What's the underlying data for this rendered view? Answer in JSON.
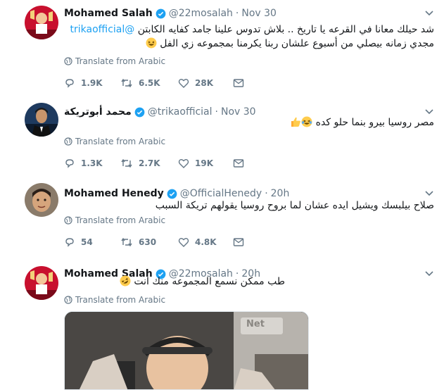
{
  "tweets": [
    {
      "name": "Mohamed Salah",
      "handle": "@22mosalah",
      "time": "Nov 30",
      "mention": "@trikaofficial",
      "line1": " شد حيلك معانا في القرعه يا تاريخ .. بلاش تدوس علينا جامد كفايه الكابتن",
      "line2": "مجدي زمانه بيصلي من أسبوع علشان ربنا يكرمنا بمجموعه زي الفل",
      "translate": "Translate from Arabic",
      "replies": "1.9K",
      "retweets": "6.5K",
      "likes": "28K"
    },
    {
      "name": "محمد أبوتريكة",
      "handle": "@trikaofficial",
      "time": "Nov 30",
      "line1": "مصر روسيا بيرو بنما حلو كده",
      "translate": "Translate from Arabic",
      "replies": "1.3K",
      "retweets": "2.7K",
      "likes": "19K"
    },
    {
      "name": "Mohamed Henedy",
      "handle": "@OfficialHenedy",
      "time": "20h",
      "line1": "صلاح بيلبسك ويشيل ايده عشان لما بروح روسيا يقولهم تريكة السبب",
      "translate": "Translate from Arabic",
      "replies": "54",
      "retweets": "630",
      "likes": "4.8K"
    },
    {
      "name": "Mohamed Salah",
      "handle": "@22mosalah",
      "time": "20h",
      "line1": "طب ممكن نسمع المجموعه منك انت",
      "translate": "Translate from Arabic",
      "media_watermark": "Net"
    }
  ],
  "colors": {
    "accent": "#1da1f2",
    "muted": "#657786",
    "thread_line": "#ccd6dd",
    "verified": "#1da1f2"
  },
  "icons": [
    "caret-down-icon",
    "verified-badge-icon",
    "globe-icon",
    "reply-icon",
    "retweet-icon",
    "like-icon",
    "message-icon",
    "laughing-emoji",
    "thumbs-up-emoji",
    "rofl-emoji"
  ]
}
